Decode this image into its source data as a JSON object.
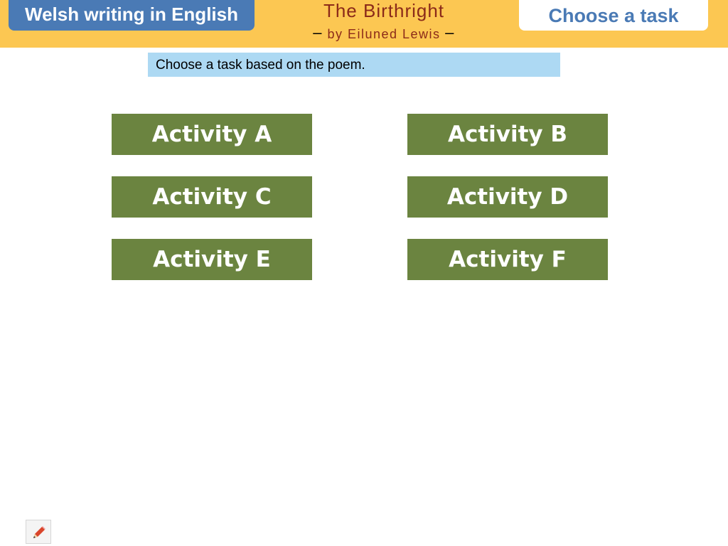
{
  "header": {
    "series_label": "Welsh writing in English",
    "poem_title": "The Birthright",
    "poem_author": "by Eiluned Lewis",
    "dash": "–",
    "choose_task_label": "Choose a task"
  },
  "instruction": {
    "text": "Choose a task based on the poem."
  },
  "activities": [
    {
      "label": "Activity A"
    },
    {
      "label": "Activity B"
    },
    {
      "label": "Activity C"
    },
    {
      "label": "Activity D"
    },
    {
      "label": "Activity E"
    },
    {
      "label": "Activity F"
    }
  ],
  "tools": {
    "pencil_icon": "pencil-icon"
  },
  "colors": {
    "header_bg": "#fcc752",
    "series_badge_bg": "#4a7ab5",
    "title_color": "#8b2a19",
    "instruction_bg": "#add9f3",
    "activity_bg": "#6b8440"
  }
}
